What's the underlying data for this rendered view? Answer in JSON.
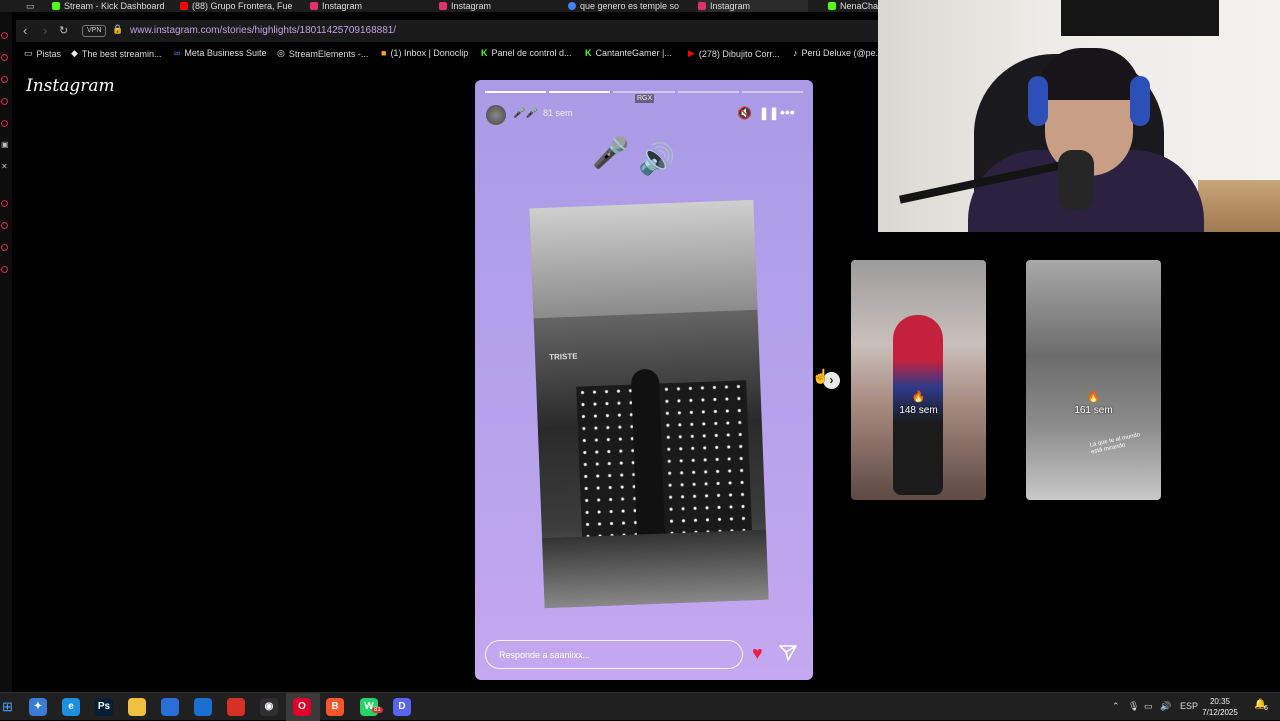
{
  "browser": {
    "tabs": [
      {
        "label": "Stream - Kick Dashboard",
        "color": "#53fc18"
      },
      {
        "label": "(88) Grupo Frontera, Fue",
        "color": "#ff0000"
      },
      {
        "label": "Instagram",
        "color": "#e1306c"
      },
      {
        "label": "Instagram",
        "color": "#e1306c"
      },
      {
        "label": "que genero es temple so",
        "color": "#4285f4"
      },
      {
        "label": "Instagram",
        "color": "#e1306c"
      },
      {
        "label": "NenaCha",
        "color": "#53fc18"
      }
    ],
    "vpn_label": "VPN",
    "url": "www.instagram.com/stories/highlights/18011425709168881/",
    "bookmarks": [
      {
        "label": "Pistas",
        "icon": "folder-icon"
      },
      {
        "label": "The best streamin...",
        "icon": "diamond-icon"
      },
      {
        "label": "Meta Business Suite",
        "icon": "meta-icon"
      },
      {
        "label": "StreamElements -...",
        "icon": "streamelements-icon"
      },
      {
        "label": "(1) Inbox | Donoclip",
        "icon": "donoclip-icon"
      },
      {
        "label": "Panel de control d...",
        "icon": "kick-icon"
      },
      {
        "label": "CantanteGamer |...",
        "icon": "kick-icon"
      },
      {
        "label": "(278) Dibujito Corr...",
        "icon": "youtube-icon"
      },
      {
        "label": "Perú Deluxe (@pe...",
        "icon": "tiktok-icon"
      }
    ]
  },
  "instagram": {
    "logo": "Instagram",
    "story": {
      "badge": "RGX",
      "username": "🎤🎤",
      "time": "81 sem",
      "emoji_mic": "🎤",
      "emoji_speaker": "🔊",
      "photo_sign": "TRISTE",
      "reply_placeholder": "Responde a saaniixx...",
      "progress_total": 5,
      "progress_done": 2
    },
    "side_stories": [
      {
        "time": "148 sem",
        "emoji": "🔥"
      },
      {
        "time": "161 sem",
        "emoji": "🔥",
        "overlay_text": "La que te al mundo está mirando"
      }
    ]
  },
  "taskbar": {
    "apps": [
      {
        "name": "copilot-icon",
        "color": "#3a7bd5",
        "label": "✦"
      },
      {
        "name": "edge-icon",
        "color": "#1d8fe0",
        "label": "e"
      },
      {
        "name": "photoshop-icon",
        "color": "#001e36",
        "label": "Ps"
      },
      {
        "name": "file-explorer-icon",
        "color": "#f0c040",
        "label": ""
      },
      {
        "name": "store-icon",
        "color": "#2b6fd6",
        "label": ""
      },
      {
        "name": "mail-icon",
        "color": "#1b6fd1",
        "label": ""
      },
      {
        "name": "app-red-icon",
        "color": "#d93025",
        "label": ""
      },
      {
        "name": "obs-icon",
        "color": "#302e31",
        "label": "◉"
      },
      {
        "name": "opera-icon",
        "color": "#e0002a",
        "label": "O"
      },
      {
        "name": "brave-icon",
        "color": "#fb542b",
        "label": "B"
      },
      {
        "name": "whatsapp-icon",
        "color": "#25d366",
        "label": "W"
      },
      {
        "name": "discord-icon",
        "color": "#5865f2",
        "label": "D"
      }
    ],
    "whatsapp_badge": "81",
    "language": "ESP",
    "time": "20:35",
    "date": "7/12/2025",
    "notification_count": "6"
  }
}
